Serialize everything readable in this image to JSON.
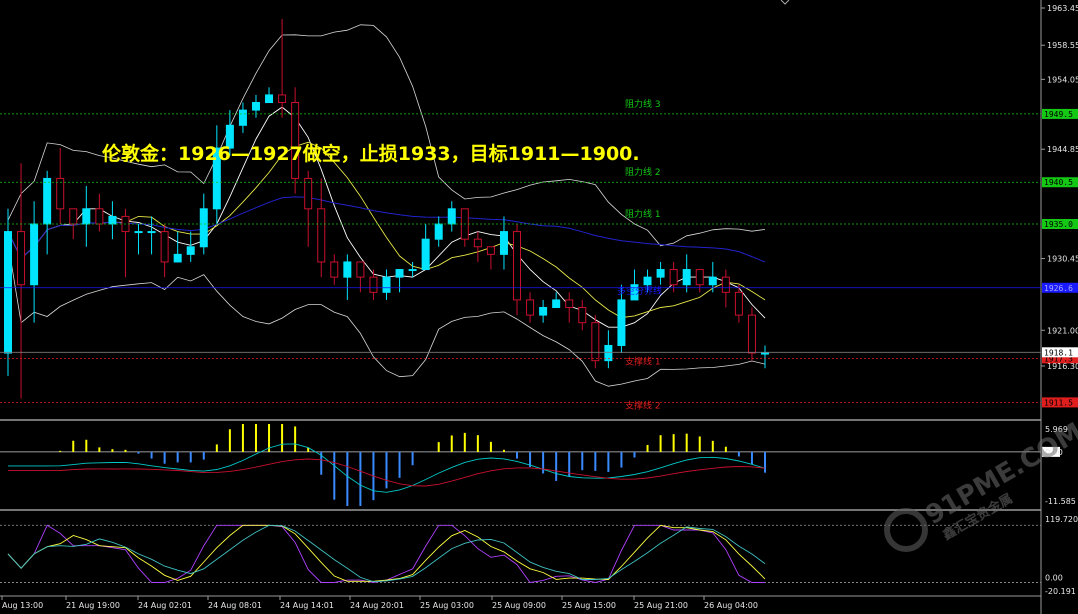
{
  "title": "伦敦金：1926—1927做空，止损1933，目标1911—1900.",
  "watermark": {
    "brand": "91PME.COM",
    "sub": "鑫汇宝贵金属"
  },
  "colors": {
    "background": "#000000",
    "bull": "#00e5ff",
    "bear": "#c8102e",
    "resistance": "#14c814",
    "support": "#e01e1e",
    "pivot": "#1a1aff",
    "title": "#ffff00",
    "band": "#d8d8d8",
    "ma_long": "#2222cc",
    "ma_fast": "#ffffff",
    "ma_slow": "#e8e84a"
  },
  "chart_data": [
    {
      "type": "candlestick",
      "ylim": [
        1910.5,
        1963.45
      ],
      "yticks": [
        "1963.45",
        "1958.55",
        "1954.05",
        "1944.85",
        "1930.45",
        "1921.00",
        "1916.30"
      ],
      "xticks": [
        "Aug 13:00",
        "21 Aug 19:00",
        "24 Aug 02:01",
        "24 Aug 08:01",
        "24 Aug 14:01",
        "24 Aug 20:01",
        "25 Aug 03:00",
        "25 Aug 09:00",
        "25 Aug 15:00",
        "25 Aug 21:00",
        "26 Aug 04:00"
      ],
      "candles": [
        [
          1918,
          1934,
          1937,
          1915
        ],
        [
          1934,
          1927,
          1943,
          1912
        ],
        [
          1927,
          1935,
          1938,
          1922
        ],
        [
          1935,
          1941,
          1942,
          1931
        ],
        [
          1941,
          1937,
          1945,
          1935
        ],
        [
          1937,
          1935,
          1937,
          1933
        ],
        [
          1935,
          1937,
          1940,
          1932
        ],
        [
          1937,
          1935,
          1939,
          1934
        ],
        [
          1935,
          1936,
          1938,
          1933
        ],
        [
          1936,
          1934,
          1937,
          1928
        ],
        [
          1934,
          1934,
          1935,
          1931
        ],
        [
          1934,
          1934,
          1936,
          1931
        ],
        [
          1934,
          1930,
          1935,
          1928
        ],
        [
          1930,
          1931,
          1934,
          1930
        ],
        [
          1931,
          1932,
          1934,
          1930
        ],
        [
          1932,
          1937,
          1939,
          1931
        ],
        [
          1937,
          1945,
          1948,
          1935
        ],
        [
          1945,
          1948,
          1950,
          1944
        ],
        [
          1948,
          1950,
          1951,
          1947
        ],
        [
          1950,
          1951,
          1952,
          1949
        ],
        [
          1951,
          1952,
          1953,
          1951
        ],
        [
          1952,
          1951,
          1962,
          1949
        ],
        [
          1951,
          1941,
          1953,
          1939
        ],
        [
          1941,
          1937,
          1942,
          1932
        ],
        [
          1937,
          1930,
          1941,
          1928
        ],
        [
          1930,
          1928,
          1931,
          1927
        ],
        [
          1928,
          1930,
          1931,
          1925
        ],
        [
          1930,
          1928,
          1930,
          1926
        ],
        [
          1928,
          1926,
          1929,
          1925
        ],
        [
          1926,
          1928,
          1929,
          1925
        ],
        [
          1928,
          1929,
          1929,
          1926
        ],
        [
          1929,
          1929,
          1930,
          1928
        ],
        [
          1929,
          1933,
          1935,
          1929
        ],
        [
          1933,
          1935,
          1936,
          1932
        ],
        [
          1935,
          1937,
          1938,
          1934
        ],
        [
          1937,
          1933,
          1937,
          1932
        ],
        [
          1933,
          1932,
          1934,
          1930
        ],
        [
          1932,
          1931,
          1932,
          1929
        ],
        [
          1931,
          1934,
          1936,
          1929
        ],
        [
          1934,
          1925,
          1935,
          1923
        ],
        [
          1925,
          1923,
          1926,
          1922
        ],
        [
          1923,
          1924,
          1925,
          1922
        ],
        [
          1924,
          1925,
          1926,
          1924
        ],
        [
          1925,
          1924,
          1926,
          1922
        ],
        [
          1924,
          1922,
          1925,
          1921
        ],
        [
          1922,
          1917,
          1923,
          1916
        ],
        [
          1917,
          1919,
          1921,
          1916
        ],
        [
          1919,
          1925,
          1927,
          1918
        ],
        [
          1925,
          1927,
          1929,
          1925
        ],
        [
          1927,
          1928,
          1929,
          1926
        ],
        [
          1928,
          1929,
          1930,
          1927
        ],
        [
          1929,
          1927,
          1930,
          1926
        ],
        [
          1927,
          1929,
          1931,
          1926
        ],
        [
          1929,
          1927,
          1929,
          1926
        ],
        [
          1927,
          1928,
          1930,
          1926
        ],
        [
          1928,
          1926,
          1929,
          1924
        ],
        [
          1926,
          1923,
          1927,
          1922
        ],
        [
          1923,
          1918,
          1924,
          1917
        ],
        [
          1918,
          1918,
          1919,
          1916
        ]
      ],
      "levels": [
        {
          "label": "阻力线 3",
          "value": 1949.5,
          "tag": "1949.5"
        },
        {
          "label": "阻力线 2",
          "value": 1940.5,
          "tag": "1940.5"
        },
        {
          "label": "阻力线 1",
          "value": 1935.0,
          "tag": "1935.0"
        },
        {
          "label": "多空分界线",
          "value": 1926.6,
          "tag": "1926.6"
        },
        {
          "label": "支撑线 1",
          "value": 1917.3,
          "tag": "1917.3"
        },
        {
          "label": "支撑线 2",
          "value": 1911.5,
          "tag": "1911.5"
        }
      ],
      "current_price": "1918.1"
    },
    {
      "type": "histogram",
      "ylim": [
        -11.585,
        5.969
      ],
      "yticks": [
        "5.969",
        "0.00",
        "-11.585"
      ]
    },
    {
      "type": "line",
      "ylim": [
        -20.191,
        119.72
      ],
      "yticks": [
        "119.720",
        "0.00",
        "-20.191"
      ]
    }
  ]
}
